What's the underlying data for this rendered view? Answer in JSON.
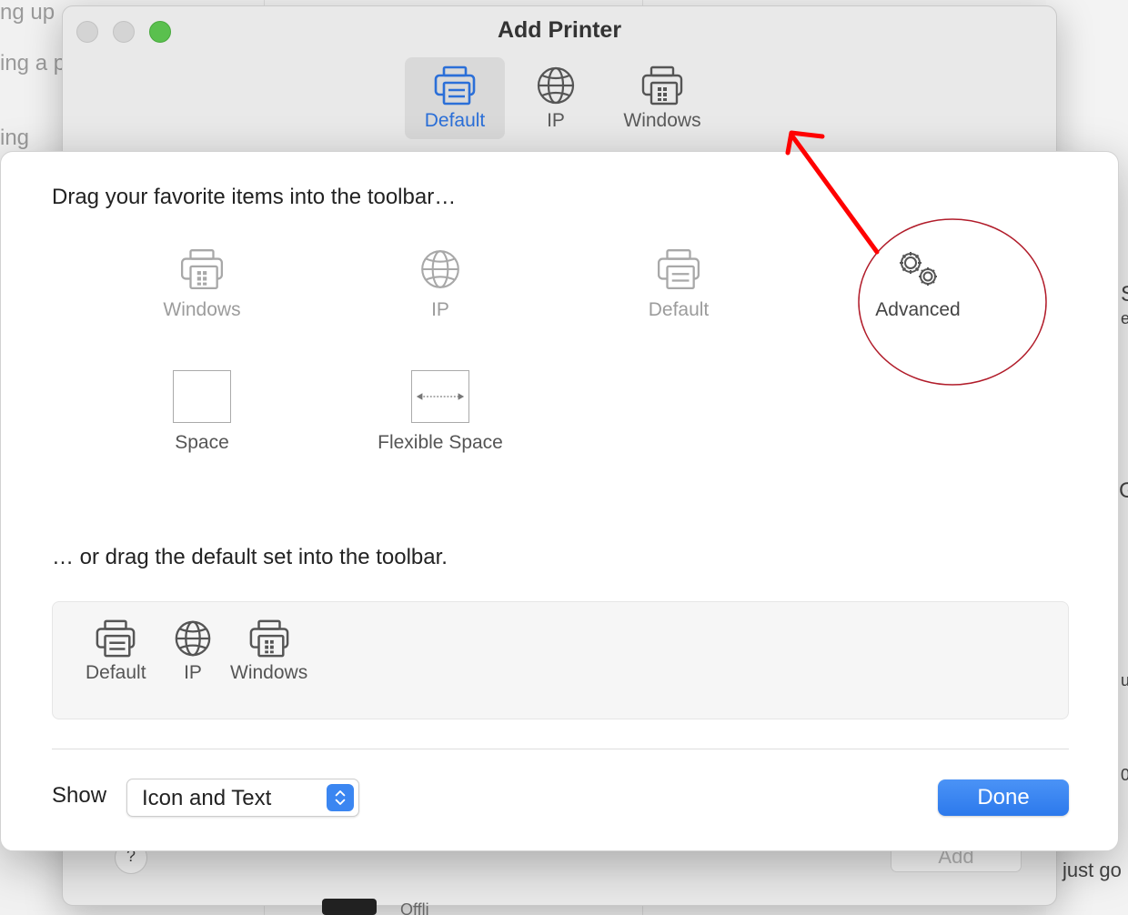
{
  "background": {
    "left_fragments": [
      "ng up",
      "ing a p",
      "ing"
    ],
    "right_fragments": [
      "S",
      "e",
      "G",
      "u",
      "0",
      "just go"
    ],
    "bottom_fragment": "Offli"
  },
  "window": {
    "title": "Add Printer",
    "toolbar": [
      {
        "label": "Default",
        "icon": "printer-default-icon",
        "selected": true
      },
      {
        "label": "IP",
        "icon": "globe-icon",
        "selected": false
      },
      {
        "label": "Windows",
        "icon": "printer-windows-icon",
        "selected": false
      }
    ],
    "add_button_label": "Add",
    "help_label": "?"
  },
  "sheet": {
    "heading_items": "Drag your favorite items into the toolbar…",
    "palette": [
      {
        "label": "Windows",
        "icon": "printer-windows-icon"
      },
      {
        "label": "IP",
        "icon": "globe-icon"
      },
      {
        "label": "Default",
        "icon": "printer-default-icon"
      },
      {
        "label": "Advanced",
        "icon": "gears-icon"
      },
      {
        "label": "Space",
        "icon": "space-icon"
      },
      {
        "label": "Flexible Space",
        "icon": "flexible-space-icon"
      }
    ],
    "heading_default": "… or drag the default set into the toolbar.",
    "default_set": [
      {
        "label": "Default",
        "icon": "printer-default-icon"
      },
      {
        "label": "IP",
        "icon": "globe-icon"
      },
      {
        "label": "Windows",
        "icon": "printer-windows-icon"
      }
    ],
    "show_label": "Show",
    "show_select": {
      "value": "Icon and Text"
    },
    "done_label": "Done"
  },
  "colors": {
    "accent": "#2b6fd8",
    "done_button": "#2f7cf0",
    "annotation_arrow": "#ff0000",
    "annotation_circle": "#b11c2a"
  }
}
